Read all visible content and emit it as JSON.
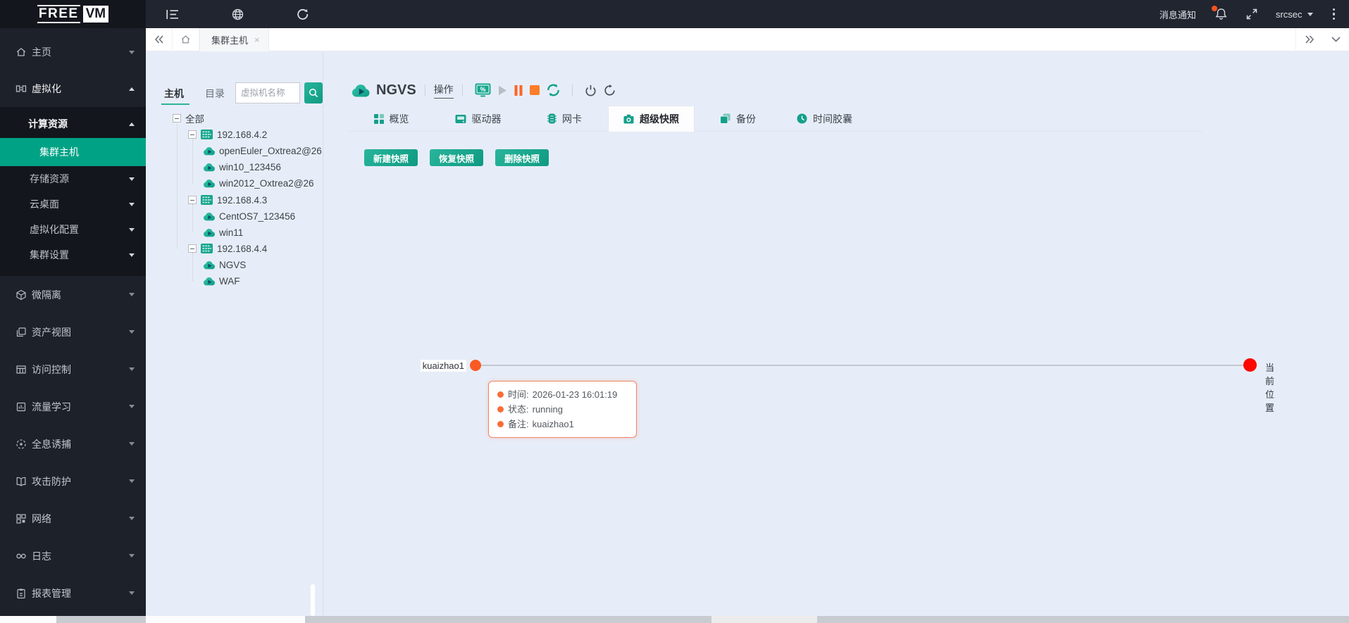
{
  "topbar": {
    "logo_free": "FREE",
    "logo_vm": "VM",
    "notifications": "消息通知",
    "username": "srcsec"
  },
  "tabbar": {
    "active_tab": "集群主机"
  },
  "sidebar": {
    "home": "主页",
    "virtualization": "虚拟化",
    "compute_resources": "计算资源",
    "cluster_hosts": "集群主机",
    "storage_resources": "存储资源",
    "cloud_desktop": "云桌面",
    "virtualization_config": "虚拟化配置",
    "cluster_settings": "集群设置",
    "micro_segmentation": "微隔离",
    "asset_view": "资产视图",
    "access_control": "访问控制",
    "traffic_learning": "流量学习",
    "holographic_trap": "全息诱捕",
    "attack_protection": "攻击防护",
    "network": "网络",
    "logs": "日志",
    "report_management": "报表管理"
  },
  "tree_panel": {
    "tab_host": "主机",
    "tab_directory": "目录",
    "search_placeholder": "虚拟机名称",
    "root_label": "全部",
    "hosts": [
      {
        "ip": "192.168.4.2",
        "vms": [
          "openEuler_Oxtrea2@26",
          "win10_123456",
          "win2012_Oxtrea2@26"
        ]
      },
      {
        "ip": "192.168.4.3",
        "vms": [
          "CentOS7_123456",
          "win11"
        ]
      },
      {
        "ip": "192.168.4.4",
        "vms": [
          "NGVS",
          "WAF"
        ]
      }
    ]
  },
  "main": {
    "vm_title": "NGVS",
    "operation_label": "操作",
    "tabs": {
      "overview": "概览",
      "drives": "驱动器",
      "nics": "网卡",
      "snapshots": "超级快照",
      "backup": "备份",
      "time_capsule": "时间胶囊"
    },
    "actions": {
      "create_snapshot": "新建快照",
      "restore_snapshot": "恢复快照",
      "delete_snapshot": "删除快照"
    },
    "timeline": {
      "snapshot_name": "kuaizhao1",
      "current_position": "当前位置"
    },
    "tooltip": {
      "time_label": "时间:",
      "time_value": "2026-01-23 16:01:19",
      "status_label": "状态:",
      "status_value": "running",
      "note_label": "备注:",
      "note_value": "kuaizhao1"
    }
  },
  "colors": {
    "accent_teal": "#00a285",
    "button_teal_gradient": [
      "#28b59b",
      "#0f9a82"
    ],
    "orange": "#fb6526",
    "snapshot_dot_orange": "#f95b22",
    "current_dot_red": "#fe0602",
    "tooltip_border": "#f5835f",
    "sidebar_bg": "#1d2129",
    "content_bg": "#e7edf8"
  }
}
